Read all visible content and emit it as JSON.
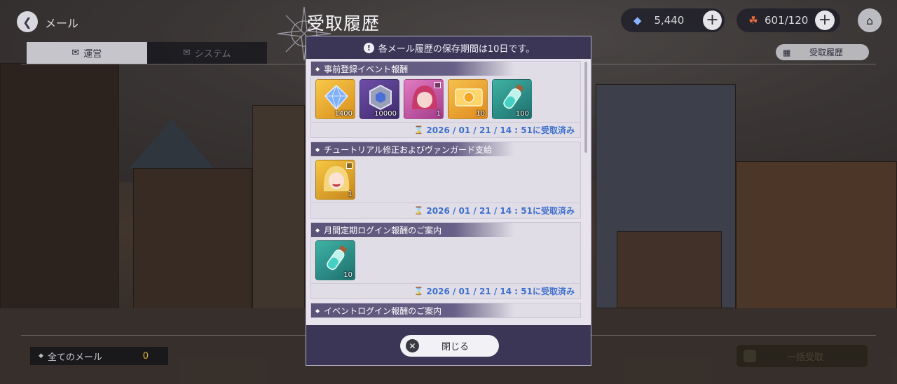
{
  "header": {
    "back_label": "メール",
    "title": "受取履歴"
  },
  "currency": [
    {
      "icon": "crystal-icon",
      "value": "5,440"
    },
    {
      "icon": "stamina-icon",
      "value": "601/120"
    }
  ],
  "tabs": [
    {
      "label": "運営",
      "active": true
    },
    {
      "label": "システム",
      "active": false
    }
  ],
  "history_button": {
    "label": "受取履歴"
  },
  "footer": {
    "all_mail_label": "全てのメール",
    "all_mail_count": "0",
    "bulk_receive_label": "一括受取"
  },
  "modal": {
    "notice": "各メール履歴の保存期間は10日です。",
    "entries": [
      {
        "title": "事前登録イベント報酬",
        "items": [
          {
            "icon": "crystal-icon",
            "qty": "1400"
          },
          {
            "icon": "medal-icon",
            "qty": "10000"
          },
          {
            "icon": "character-portrait-icon",
            "qty": "1"
          },
          {
            "icon": "ticket-icon",
            "qty": "10"
          },
          {
            "icon": "potion-icon",
            "qty": "100"
          }
        ],
        "date": "2026 / 01 / 21 / 14 : 51に受取済み"
      },
      {
        "title": "チュートリアル修正およびヴァンガード支給",
        "items": [
          {
            "icon": "character-portrait-icon",
            "qty": "1"
          }
        ],
        "date": "2026 / 01 / 21 / 14 : 51に受取済み"
      },
      {
        "title": "月間定期ログイン報酬のご案内",
        "items": [
          {
            "icon": "potion-icon",
            "qty": "10"
          }
        ],
        "date": "2026 / 01 / 21 / 14 : 51に受取済み"
      },
      {
        "title": "イベントログイン報酬のご案内"
      }
    ],
    "close_label": "閉じる"
  }
}
